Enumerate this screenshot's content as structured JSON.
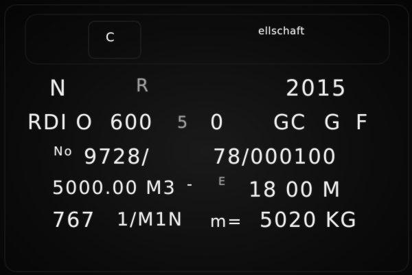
{
  "header": {
    "mark": "C",
    "maker": "ellschaft"
  },
  "rows": [
    {
      "left": "N",
      "mid": "R",
      "right": "2015"
    },
    {
      "a": "RDI O",
      "b": "600",
      "c": "5",
      "d": "0",
      "e": "GC",
      "f": "G",
      "g": "F"
    },
    {
      "a": "No",
      "b": "9728/",
      "c": "78/000100"
    },
    {
      "a": "5000.00 M3",
      "b": "-",
      "c": "E",
      "d": "18 00 M"
    },
    {
      "a": "767",
      "b": "1/M1N",
      "c": "m=",
      "d": "5020 KG"
    }
  ]
}
